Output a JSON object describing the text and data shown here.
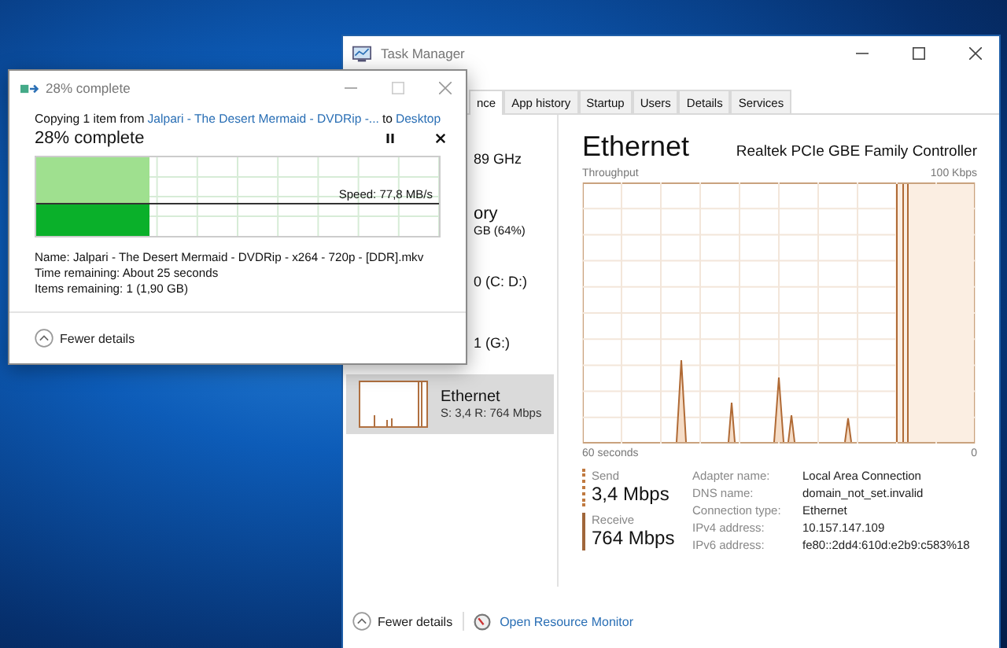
{
  "copy_dialog": {
    "title": "28% complete",
    "copying_prefix": "Copying 1 item from",
    "source": "Jalpari - The Desert Mermaid  - DVDRip -...",
    "to_word": "to",
    "destination": "Desktop",
    "status": "28% complete",
    "level": 0.28,
    "speed": "Speed: 77,8 MB/s",
    "details": [
      {
        "label": "Name:",
        "value": "Jalpari - The Desert Mermaid  - DVDRip - x264 -  720p - [DDR].mkv"
      },
      {
        "label": "Time remaining:",
        "value": "About 25 seconds"
      },
      {
        "label": "Items remaining:",
        "value": "1 (1,90 GB)"
      }
    ],
    "fewer_details": "Fewer details"
  },
  "task_manager": {
    "title": "Task Manager",
    "tabs": [
      {
        "label": "nce",
        "selected": true
      },
      {
        "label": "App history",
        "selected": false
      },
      {
        "label": "Startup",
        "selected": false
      },
      {
        "label": "Users",
        "selected": false
      },
      {
        "label": "Details",
        "selected": false
      },
      {
        "label": "Services",
        "selected": false
      }
    ],
    "sidebar": [
      {
        "kind": "clipped",
        "lines": [
          "89 GHz"
        ],
        "selected": false
      },
      {
        "kind": "clipped",
        "lines": [
          "ory",
          "GB (64%)"
        ],
        "selected": false
      },
      {
        "kind": "clipped",
        "lines": [
          "0 (C: D:)"
        ],
        "selected": false
      },
      {
        "kind": "clipped",
        "lines": [
          "1 (G:)"
        ],
        "selected": false
      },
      {
        "kind": "full",
        "lines": [
          "Ethernet",
          "S: 3,4 R: 764 Mbps"
        ],
        "selected": true
      }
    ],
    "heading": "Ethernet",
    "adapter": "Realtek PCIe GBE Family Controller",
    "graph_label": "Throughput",
    "graph_max": "100 Kbps",
    "time_span": "60 seconds",
    "time_end": "0",
    "stats": [
      {
        "kind": "send",
        "label": "Send",
        "value": "3,4 Mbps"
      },
      {
        "kind": "receive",
        "label": "Receive",
        "value": "764 Mbps"
      }
    ],
    "info": [
      {
        "label": "Adapter name:",
        "value": "Local Area Connection"
      },
      {
        "label": "DNS name:",
        "value": "domain_not_set.invalid"
      },
      {
        "label": "Connection type:",
        "value": "Ethernet"
      },
      {
        "label": "IPv4 address:",
        "value": "10.157.147.109"
      },
      {
        "label": "IPv6 address:",
        "value": "fe80::2dd4:610d:e2b9:c583%18"
      }
    ],
    "fewer_details": "Fewer details",
    "resource_monitor": "Open Resource Monitor"
  }
}
